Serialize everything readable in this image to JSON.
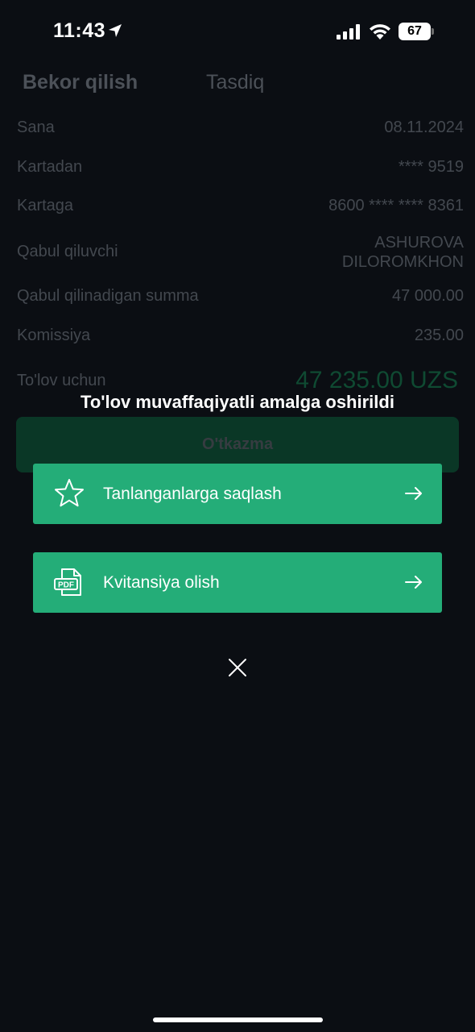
{
  "status_bar": {
    "time": "11:43",
    "battery": "67"
  },
  "background_form": {
    "tabs": {
      "cancel": "Bekor qilish",
      "confirm": "Tasdiq"
    },
    "rows": [
      {
        "label": "Sana",
        "value": "08.11.2024"
      },
      {
        "label": "Kartadan",
        "value": "**** 9519"
      },
      {
        "label": "Kartaga",
        "value": "8600 **** **** 8361"
      },
      {
        "label": "Qabul qiluvchi",
        "value_line1": "ASHUROVA",
        "value_line2": "DILOROMKHON"
      },
      {
        "label": "Qabul qilinadigan summa",
        "value": "47 000.00"
      },
      {
        "label": "Komissiya",
        "value": "235.00"
      },
      {
        "label": "To'lov uchun",
        "value": "47 235.00 UZS"
      }
    ],
    "submit_label": "O'tkazma"
  },
  "overlay": {
    "title": "To'lov muvaffaqiyatli amalga oshirildi",
    "actions": [
      {
        "label": "Tanlanganlarga saqlash",
        "icon": "star-icon"
      },
      {
        "label": "Kvitansiya olish",
        "icon": "pdf-file-icon",
        "icon_text": "PDF"
      }
    ]
  },
  "colors": {
    "accent": "#24ad78",
    "background": "#0b0e13"
  }
}
